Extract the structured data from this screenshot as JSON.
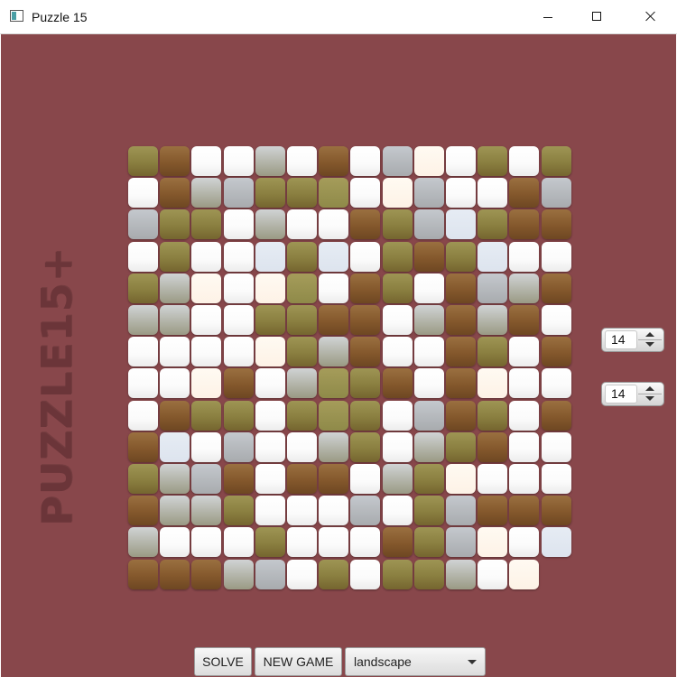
{
  "window": {
    "title": "Puzzle 15"
  },
  "logo": {
    "text": "PUZZLE15+"
  },
  "board": {
    "size": 14,
    "tiles": [
      [
        "grass",
        "brown",
        "white",
        "white",
        "mist",
        "white",
        "brown",
        "white",
        "gray",
        "cream",
        "white",
        "grass",
        "white",
        "grass"
      ],
      [
        "white",
        "brown",
        "mist",
        "gray",
        "grass",
        "grass",
        "olive",
        "white",
        "cream",
        "gray",
        "white",
        "white",
        "brown",
        "gray"
      ],
      [
        "gray",
        "grass",
        "grass",
        "white",
        "mist",
        "white",
        "white",
        "brown",
        "grass",
        "gray",
        "pale",
        "grass",
        "brown",
        "brown"
      ],
      [
        "white",
        "grass",
        "white",
        "white",
        "pale",
        "grass",
        "pale",
        "white",
        "grass",
        "brown",
        "grass",
        "pale",
        "white",
        "white"
      ],
      [
        "grass",
        "mist",
        "cream",
        "white",
        "cream",
        "olive",
        "white",
        "brown",
        "grass",
        "white",
        "brown",
        "gray",
        "mist",
        "brown"
      ],
      [
        "mist",
        "mist",
        "white",
        "white",
        "grass",
        "grass",
        "brown",
        "brown",
        "white",
        "mist",
        "brown",
        "mist",
        "brown",
        "white"
      ],
      [
        "white",
        "white",
        "white",
        "white",
        "cream",
        "grass",
        "mist",
        "brown",
        "white",
        "white",
        "brown",
        "grass",
        "white",
        "brown"
      ],
      [
        "white",
        "white",
        "cream",
        "brown",
        "white",
        "mist",
        "olive",
        "grass",
        "brown",
        "white",
        "brown",
        "cream",
        "white",
        "white"
      ],
      [
        "white",
        "brown",
        "grass",
        "grass",
        "white",
        "grass",
        "olive",
        "grass",
        "white",
        "gray",
        "brown",
        "grass",
        "white",
        "brown"
      ],
      [
        "brown",
        "pale",
        "white",
        "gray",
        "white",
        "white",
        "mist",
        "grass",
        "white",
        "mist",
        "grass",
        "brown",
        "white",
        "white"
      ],
      [
        "grass",
        "mist",
        "gray",
        "brown",
        "white",
        "brown",
        "brown",
        "white",
        "mist",
        "grass",
        "cream",
        "white",
        "white",
        "white"
      ],
      [
        "brown",
        "mist",
        "mist",
        "grass",
        "white",
        "white",
        "white",
        "gray",
        "white",
        "grass",
        "gray",
        "brown",
        "brown",
        "brown"
      ],
      [
        "mist",
        "white",
        "white",
        "white",
        "grass",
        "white",
        "white",
        "white",
        "brown",
        "grass",
        "gray",
        "cream",
        "white",
        "pale"
      ],
      [
        "brown",
        "brown",
        "brown",
        "mist",
        "gray",
        "white",
        "grass",
        "white",
        "grass",
        "grass",
        "mist",
        "white",
        "cream",
        ""
      ]
    ]
  },
  "rows_spinner": {
    "value": "14"
  },
  "cols_spinner": {
    "value": "14"
  },
  "controls": {
    "solve_label": "SOLVE",
    "new_game_label": "NEW GAME",
    "image_select_value": "landscape"
  }
}
